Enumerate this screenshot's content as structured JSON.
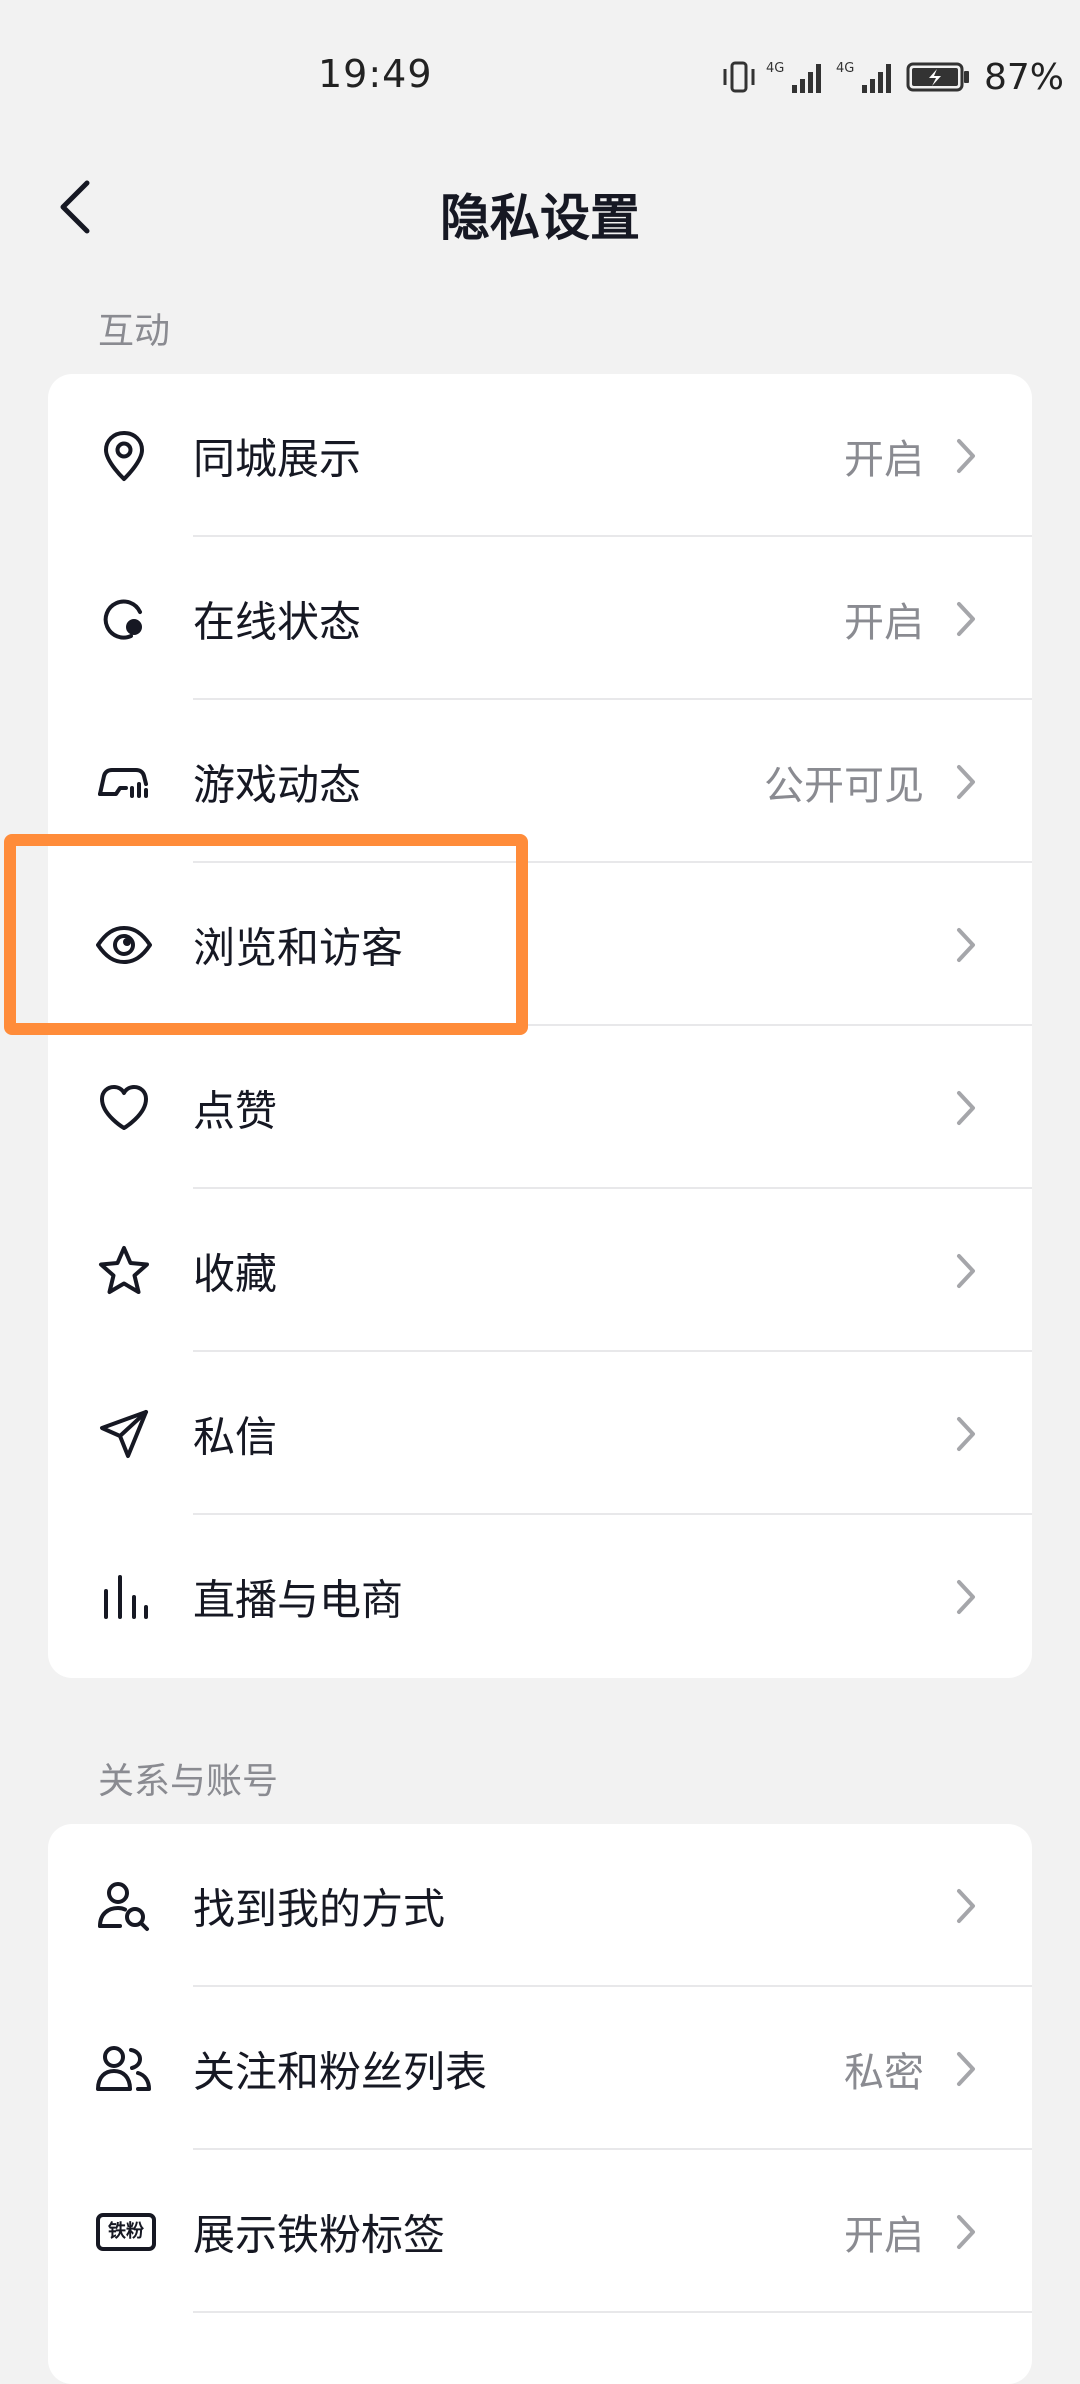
{
  "status_bar": {
    "time": "19:49",
    "battery_percent": "87%",
    "network_1": "4G",
    "network_2": "4G"
  },
  "nav": {
    "title": "隐私设置"
  },
  "sections": [
    {
      "label": "互动",
      "items": [
        {
          "label": "同城展示",
          "value": "开启",
          "icon": "location-pin-icon"
        },
        {
          "label": "在线状态",
          "value": "开启",
          "icon": "online-status-icon"
        },
        {
          "label": "游戏动态",
          "value": "公开可见",
          "icon": "gamepad-icon"
        },
        {
          "label": "浏览和访客",
          "value": "",
          "icon": "eye-icon"
        },
        {
          "label": "点赞",
          "value": "",
          "icon": "heart-icon"
        },
        {
          "label": "收藏",
          "value": "",
          "icon": "star-icon"
        },
        {
          "label": "私信",
          "value": "",
          "icon": "paper-plane-icon"
        },
        {
          "label": "直播与电商",
          "value": "",
          "icon": "bar-chart-icon"
        }
      ]
    },
    {
      "label": "关系与账号",
      "items": [
        {
          "label": "找到我的方式",
          "value": "",
          "icon": "user-search-icon"
        },
        {
          "label": "关注和粉丝列表",
          "value": "私密",
          "icon": "users-icon"
        },
        {
          "label": "展示铁粉标签",
          "value": "开启",
          "icon": "iron-fan-badge-icon",
          "badge_text": "铁粉"
        }
      ]
    }
  ],
  "colors": {
    "background": "#f2f2f2",
    "card": "#ffffff",
    "text_primary": "#161823",
    "text_secondary": "#8a8b91",
    "highlight": "#ff8c3a"
  }
}
